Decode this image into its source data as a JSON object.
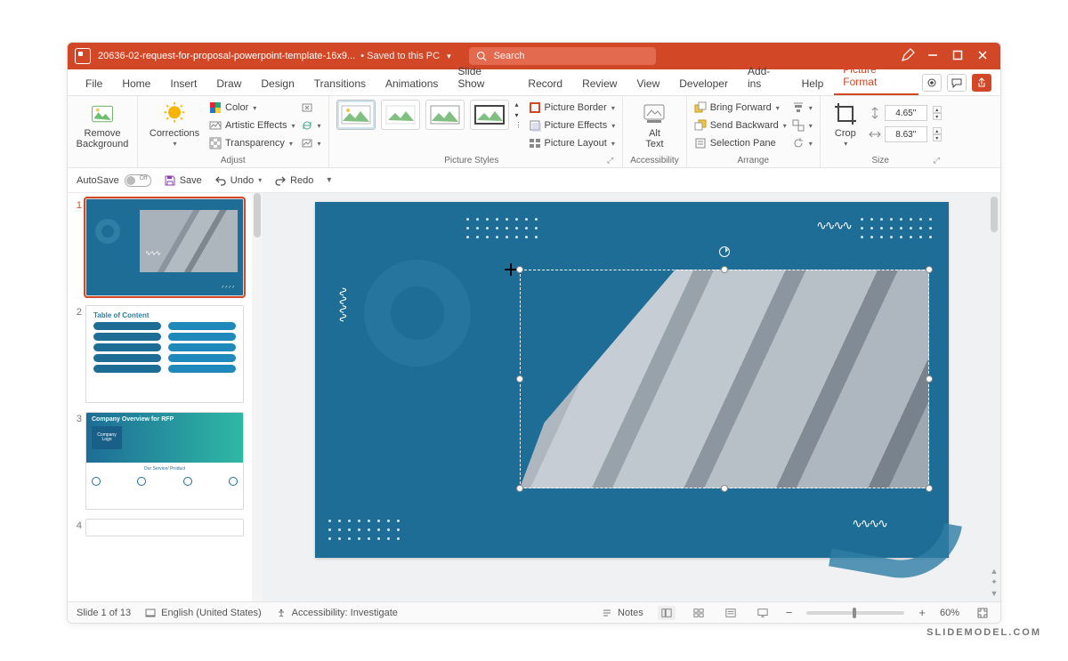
{
  "titlebar": {
    "doc_title": "20636-02-request-for-proposal-powerpoint-template-16x9...",
    "saved_label": "• Saved to this PC",
    "search_placeholder": "Search"
  },
  "ribbon_tabs": [
    "File",
    "Home",
    "Insert",
    "Draw",
    "Design",
    "Transitions",
    "Animations",
    "Slide Show",
    "Record",
    "Review",
    "View",
    "Developer",
    "Add-ins",
    "Help",
    "Picture Format"
  ],
  "active_tab": "Picture Format",
  "ribbon": {
    "remove_bg": "Remove\nBackground",
    "adjust": {
      "corrections": "Corrections",
      "color": "Color",
      "artistic": "Artistic Effects",
      "transparency": "Transparency",
      "group_label": "Adjust"
    },
    "styles": {
      "border": "Picture Border",
      "effects": "Picture Effects",
      "layout": "Picture Layout",
      "group_label": "Picture Styles"
    },
    "alt_text": {
      "label": "Alt\nText",
      "group_label": "Accessibility"
    },
    "arrange": {
      "bring_forward": "Bring Forward",
      "send_backward": "Send Backward",
      "selection_pane": "Selection Pane",
      "group_label": "Arrange"
    },
    "size": {
      "crop": "Crop",
      "height": "4.65\"",
      "width": "8.63\"",
      "group_label": "Size"
    }
  },
  "qat": {
    "autosave": "AutoSave",
    "autosave_state": "Off",
    "save": "Save",
    "undo": "Undo",
    "redo": "Redo"
  },
  "thumbs": {
    "slide1_num": "1",
    "slide2_num": "2",
    "slide2_title": "Table of Content",
    "slide3_num": "3",
    "slide3_title": "Company Overview for RFP",
    "slide3_logo": "Company\nLogo",
    "slide3_caption": "Our Service/\nProduct",
    "slide4_num": "4"
  },
  "status": {
    "slide_counter": "Slide 1 of 13",
    "language": "English (United States)",
    "accessibility": "Accessibility: Investigate",
    "notes": "Notes",
    "zoom": "60%"
  },
  "watermark": "SLIDEMODEL.COM"
}
